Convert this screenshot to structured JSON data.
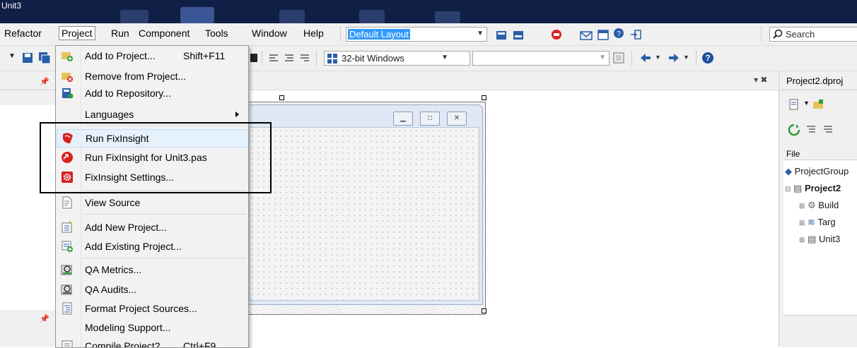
{
  "window": {
    "title": "Unit3"
  },
  "menubar": {
    "items": [
      "Refactor",
      "Project",
      "Run",
      "Component",
      "Tools",
      "Window",
      "Help"
    ],
    "layout_combo": "Default Layout",
    "search_placeholder": "Search"
  },
  "toolbar": {
    "platform_combo": "32-bit Windows"
  },
  "project_menu": {
    "items": [
      {
        "label": "Add to Project...",
        "shortcut": "Shift+F11",
        "icon": "add-to-project-icon"
      },
      {
        "label": "Remove from Project...",
        "shortcut": "",
        "icon": "remove-from-project-icon"
      },
      {
        "label": "Add to Repository...",
        "shortcut": "",
        "icon": "add-to-repository-icon"
      },
      {
        "label": "Languages",
        "shortcut": "",
        "icon": ""
      },
      {
        "label": "Run FixInsight",
        "shortcut": "",
        "icon": "fixinsight-run-icon"
      },
      {
        "label": "Run FixInsight for Unit3.pas",
        "shortcut": "",
        "icon": "fixinsight-run-unit-icon"
      },
      {
        "label": "FixInsight Settings...",
        "shortcut": "",
        "icon": "fixinsight-settings-icon"
      },
      {
        "label": "View Source",
        "shortcut": "",
        "icon": "view-source-icon"
      },
      {
        "label": "Add New Project...",
        "shortcut": "",
        "icon": "add-new-project-icon"
      },
      {
        "label": "Add Existing Project...",
        "shortcut": "",
        "icon": "add-existing-project-icon"
      },
      {
        "label": "QA Metrics...",
        "shortcut": "",
        "icon": "qa-metrics-icon"
      },
      {
        "label": "QA Audits...",
        "shortcut": "",
        "icon": "qa-audits-icon"
      },
      {
        "label": "Format Project Sources...",
        "shortcut": "",
        "icon": "format-sources-icon"
      },
      {
        "label": "Modeling Support...",
        "shortcut": "",
        "icon": ""
      },
      {
        "label": "Compile Project2",
        "shortcut": "Ctrl+F9",
        "icon": "compile-icon"
      }
    ]
  },
  "project_manager": {
    "tab_title": "Project2.dproj",
    "column_header": "File",
    "tree": [
      "ProjectGroup",
      "Project2",
      "Build",
      "Targ",
      "Unit3"
    ]
  },
  "colors": {
    "titlebar": "#0f1f45",
    "menu_highlight": "#e5f1fb",
    "selection_blue": "#3399ff",
    "fixinsight_red": "#d92020"
  }
}
